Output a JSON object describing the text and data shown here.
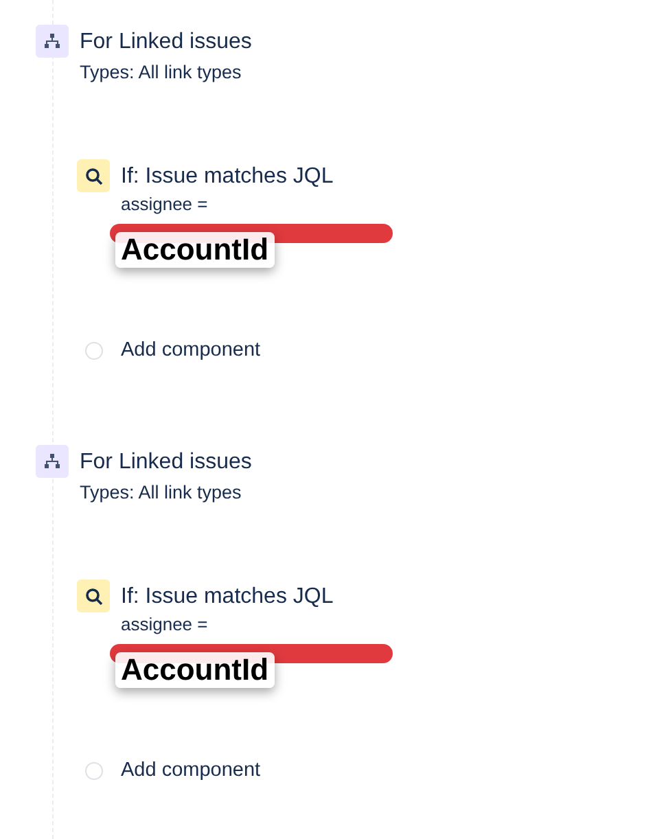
{
  "branches": [
    {
      "title": "For Linked issues",
      "subtitle": "Types: All link types",
      "condition": {
        "title": "If: Issue matches JQL",
        "query": "assignee =",
        "annotation": "AccountId"
      },
      "add_label": "Add component"
    },
    {
      "title": "For Linked issues",
      "subtitle": "Types: All link types",
      "condition": {
        "title": "If: Issue matches JQL",
        "query": "assignee =",
        "annotation": "AccountId"
      },
      "add_label": "Add component"
    }
  ]
}
